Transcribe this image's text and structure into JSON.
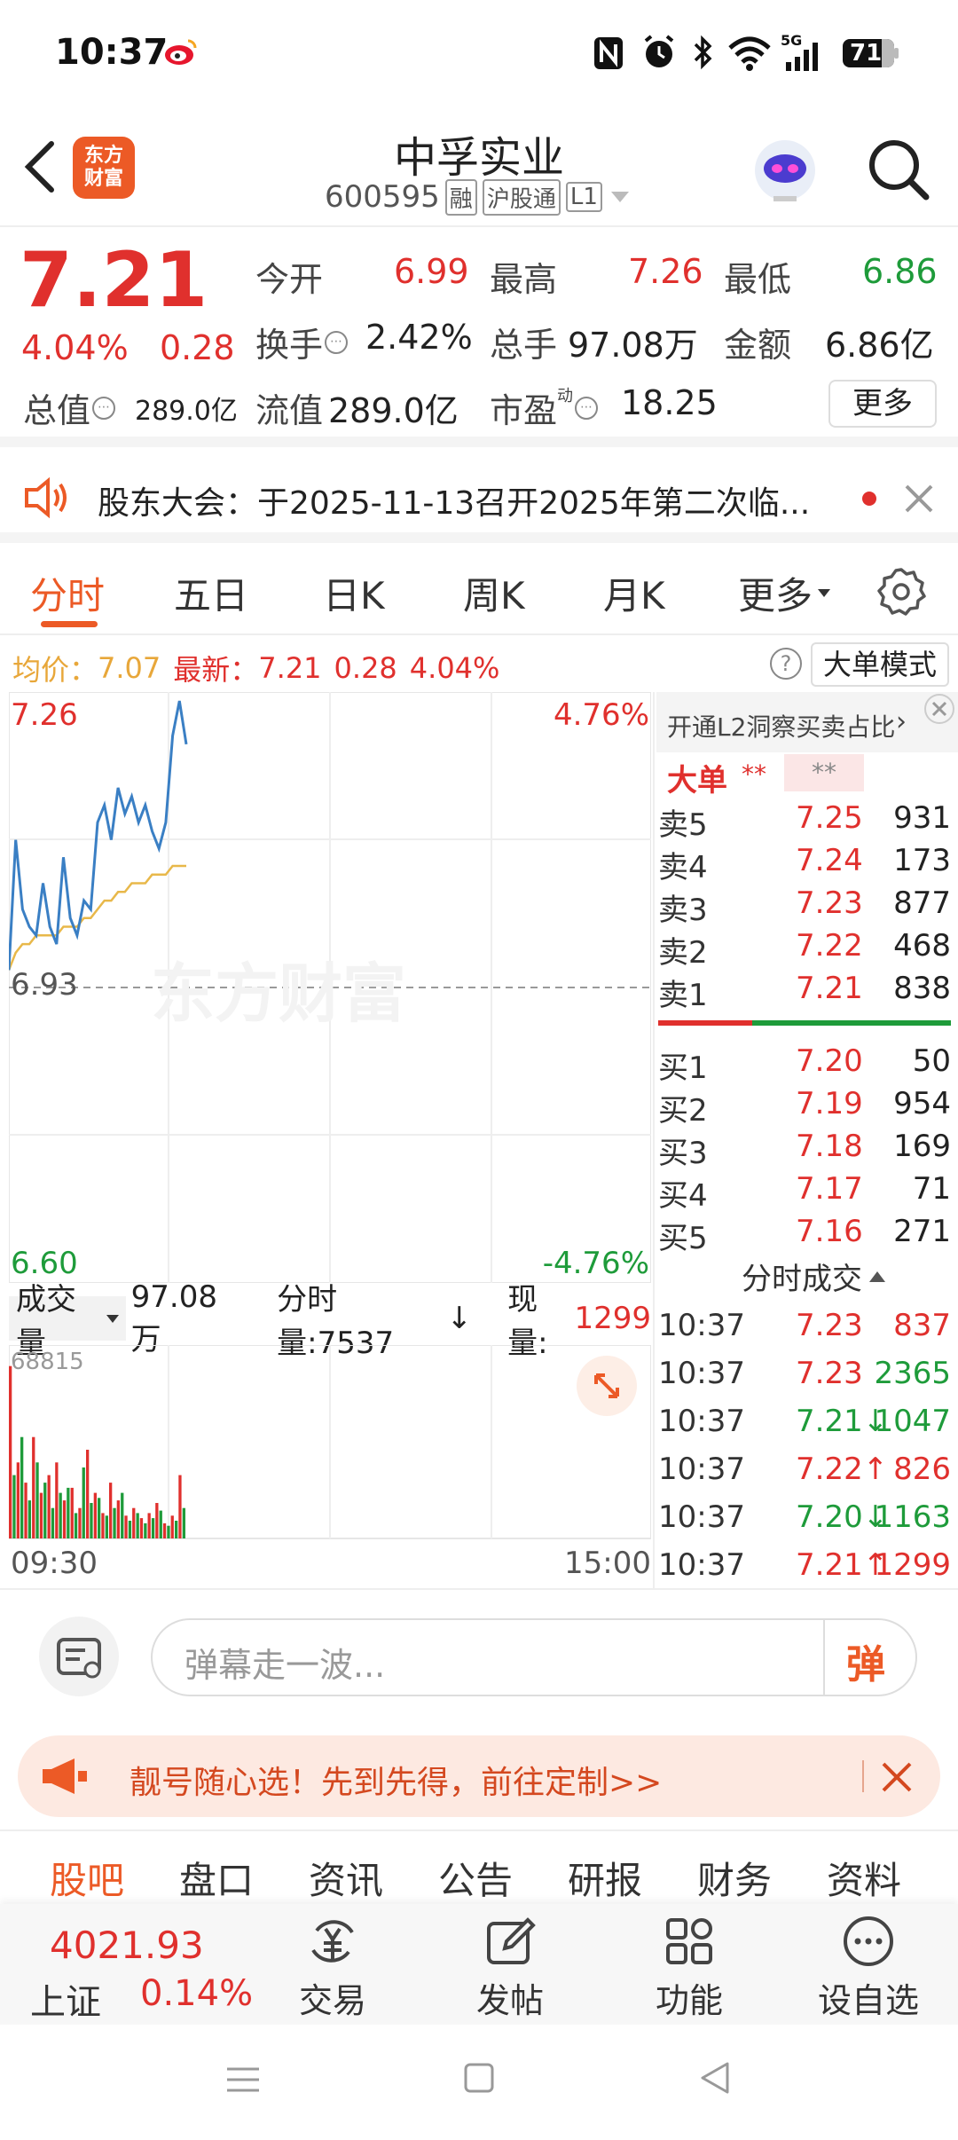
{
  "status_bar": {
    "time": "10:37",
    "battery": "71",
    "network": "5G"
  },
  "header": {
    "logo_line1": "东方",
    "logo_line2": "财富",
    "title": "中孚实业",
    "code": "600595",
    "badge_rong": "融",
    "badge_hgt": "沪股通",
    "badge_level": "L1"
  },
  "quote": {
    "price": "7.21",
    "change_pct": "4.04%",
    "change": "0.28",
    "open_label": "今开",
    "open": "6.99",
    "high_label": "最高",
    "high": "7.26",
    "low_label": "最低",
    "low": "6.86",
    "turnover_label": "换手",
    "turnover": "2.42%",
    "volume_label": "总手",
    "volume": "97.08万",
    "amount_label": "金额",
    "amount": "6.86亿",
    "mktcap_label": "总值",
    "mktcap": "289.0亿",
    "float_label": "流值",
    "float": "289.0亿",
    "pe_label": "市盈",
    "pe_sup": "动",
    "pe": "18.25",
    "more_button": "更多"
  },
  "notice": {
    "text": "股东大会：于2025-11-13召开2025年第二次临..."
  },
  "tabs": [
    "分时",
    "五日",
    "日K",
    "周K",
    "月K",
    "更多"
  ],
  "chart_header": {
    "avg_label": "均价：",
    "avg": "7.07",
    "latest_label": "最新：",
    "latest": "7.21",
    "latest_change": "0.28",
    "latest_pct": "4.04%",
    "mode_button": "大单模式"
  },
  "chart_data": {
    "type": "line",
    "price_series": {
      "values": [
        6.95,
        7.1,
        7.02,
        7.0,
        6.99,
        7.05,
        7.0,
        6.98,
        7.08,
        7.01,
        6.99,
        7.03,
        7.02,
        7.12,
        7.14,
        7.1,
        7.16,
        7.13,
        7.15,
        7.12,
        7.14,
        7.11,
        7.09,
        7.12,
        7.22,
        7.26,
        7.21
      ]
    },
    "avg_series": {
      "values": [
        6.95,
        6.97,
        6.98,
        6.98,
        6.99,
        6.99,
        6.99,
        6.99,
        7.0,
        7.0,
        7.0,
        7.01,
        7.01,
        7.02,
        7.03,
        7.03,
        7.04,
        7.04,
        7.05,
        7.05,
        7.05,
        7.06,
        7.06,
        7.06,
        7.07,
        7.07,
        7.07
      ]
    },
    "ylim": [
      6.6,
      7.26
    ],
    "y_top_label": "7.26",
    "y_mid_label": "6.93",
    "y_bottom_label": "6.60",
    "pct_top_label": "4.76%",
    "pct_bottom_label": "-4.76%",
    "volume_max_label": "68815",
    "x_start": "09:30",
    "x_end": "15:00",
    "volume_up": [
      68,
      30,
      22,
      40,
      18,
      25,
      30,
      15,
      20,
      12,
      35,
      18,
      10,
      22,
      15,
      9,
      12,
      8,
      10,
      14,
      6,
      9,
      25
    ],
    "volume_down": [
      25,
      40,
      15,
      30,
      22,
      12,
      18,
      20,
      10,
      28,
      14,
      16,
      9,
      12,
      18,
      7,
      10,
      6,
      8,
      11,
      5,
      7,
      12
    ]
  },
  "volume_bar": {
    "label": "成交量",
    "total": "97.08万",
    "minute_vol": "分时量:7537",
    "current_label": "现量:",
    "current": "1299"
  },
  "order_book": {
    "promo": "开通L2洞察买卖占比",
    "big_label": "大单",
    "big_v1": "**",
    "big_v2": "**",
    "sells": [
      {
        "label": "卖5",
        "price": "7.25",
        "vol": "931"
      },
      {
        "label": "卖4",
        "price": "7.24",
        "vol": "173"
      },
      {
        "label": "卖3",
        "price": "7.23",
        "vol": "877"
      },
      {
        "label": "卖2",
        "price": "7.22",
        "vol": "468"
      },
      {
        "label": "卖1",
        "price": "7.21",
        "vol": "838"
      }
    ],
    "buys": [
      {
        "label": "买1",
        "price": "7.20",
        "vol": "50"
      },
      {
        "label": "买2",
        "price": "7.19",
        "vol": "954"
      },
      {
        "label": "买3",
        "price": "7.18",
        "vol": "169"
      },
      {
        "label": "买4",
        "price": "7.17",
        "vol": "71"
      },
      {
        "label": "买5",
        "price": "7.16",
        "vol": "271"
      }
    ],
    "ratio_sell": 0.32
  },
  "trades": {
    "title": "分时成交",
    "rows": [
      {
        "time": "10:37",
        "price": "7.23",
        "arrow": "",
        "vol": "837",
        "color": "red"
      },
      {
        "time": "10:37",
        "price": "7.23",
        "arrow": "",
        "vol": "2365",
        "color": "green"
      },
      {
        "time": "10:37",
        "price": "7.21",
        "arrow": "↓",
        "vol": "1047",
        "color": "green"
      },
      {
        "time": "10:37",
        "price": "7.22",
        "arrow": "↑",
        "vol": "826",
        "color": "red"
      },
      {
        "time": "10:37",
        "price": "7.20",
        "arrow": "↓",
        "vol": "1163",
        "color": "green"
      },
      {
        "time": "10:37",
        "price": "7.21",
        "arrow": "↑",
        "vol": "1299",
        "color": "red"
      }
    ]
  },
  "comment": {
    "placeholder": "弹幕走一波...",
    "danmu_button": "弹"
  },
  "banner": {
    "text": "靓号随心选！先到先得，前往定制>>"
  },
  "section_tabs": [
    "股吧",
    "盘口",
    "资讯",
    "公告",
    "研报",
    "财务",
    "资料"
  ],
  "bottom_nav": {
    "index_value": "4021.93",
    "index_name": "上证",
    "index_pct": "0.14%",
    "trade": "交易",
    "post": "发帖",
    "func": "功能",
    "watch": "设自选"
  },
  "colors": {
    "up": "#e0302d",
    "down": "#1e9b3a",
    "avg_line": "#e8b84a",
    "price_line": "#3a7fc4",
    "brand": "#ec5a26"
  }
}
